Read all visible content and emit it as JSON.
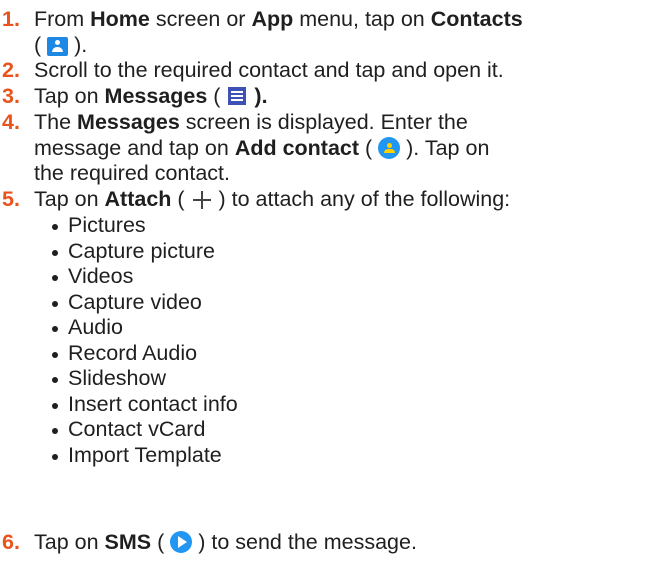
{
  "steps": [
    {
      "num": "1.",
      "line1_a": "From ",
      "line1_b": "Home",
      "line1_c": " screen or ",
      "line1_d": "App",
      "line1_e": " menu, tap on ",
      "line1_f": "Contacts",
      "line2_a": "( ",
      "line2_b": " ).",
      "icon": "contacts-icon"
    },
    {
      "num": "2.",
      "text": "Scroll to the required contact and tap and open it."
    },
    {
      "num": "3.",
      "a": "Tap on ",
      "b": "Messages",
      "c": " ( ",
      "d": " ).",
      "icon": "messages-icon"
    },
    {
      "num": "4.",
      "line1_a": "The ",
      "line1_b": "Messages",
      "line1_c": " screen is displayed. Enter the",
      "line2_a": "message and tap on ",
      "line2_b": "Add contact",
      "line2_c": " ( ",
      "line2_d": " ). Tap on",
      "line3": "the required contact.",
      "icon": "add-contact-icon"
    },
    {
      "num": "5.",
      "a": "Tap on ",
      "b": "Attach",
      "c": " ( ",
      "d": " ) to attach any of the following:",
      "icon": "plus-icon",
      "options": [
        "Pictures",
        "Capture picture",
        "Videos",
        "Capture video",
        "Audio",
        "Record Audio",
        "Slideshow",
        "Insert contact info",
        "Contact vCard",
        "Import Template"
      ]
    },
    {
      "num": "6.",
      "a": "Tap on ",
      "b": "SMS",
      "c": " ( ",
      "d": " ) to send the message.",
      "icon": "send-icon"
    }
  ],
  "colors": {
    "step_number": "#e8541c",
    "text": "#1f1f1f",
    "icon_blue": "#2196f3",
    "messages_blue": "#3f51b5"
  }
}
